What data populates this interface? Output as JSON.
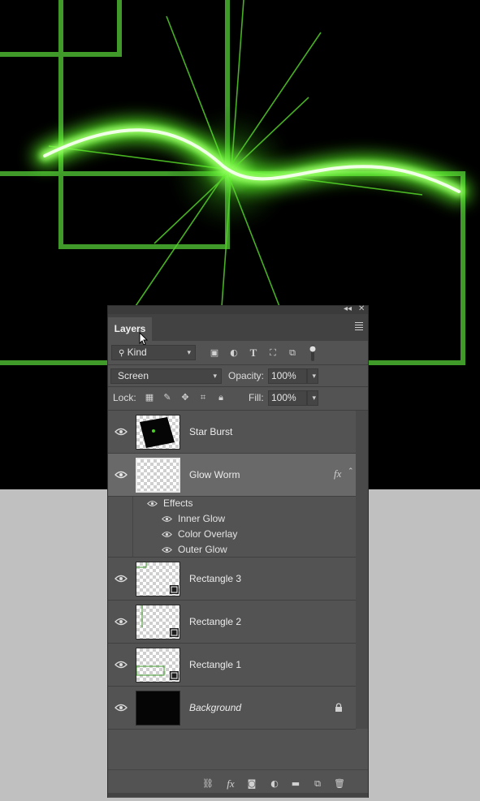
{
  "panel": {
    "collapse_label": "◂◂",
    "close_label": "✕",
    "tab_label": "Layers",
    "menu_icon": "panel-menu-icon"
  },
  "filter": {
    "kind_label": "Kind",
    "icons": [
      "pixel-filter-icon",
      "adjustment-filter-icon",
      "type-filter-icon",
      "shape-filter-icon",
      "smart-object-filter-icon",
      "filter-toggle-icon"
    ]
  },
  "blend": {
    "mode": "Screen",
    "opacity_label": "Opacity:",
    "opacity_value": "100%"
  },
  "lock": {
    "label": "Lock:",
    "fill_label": "Fill:",
    "fill_value": "100%"
  },
  "layers": [
    {
      "name": "Star Burst"
    },
    {
      "name": "Glow Worm",
      "fx": "fx",
      "selected": true
    },
    {
      "name": "Rectangle 3"
    },
    {
      "name": "Rectangle 2"
    },
    {
      "name": "Rectangle 1"
    },
    {
      "name": "Background",
      "locked": true
    }
  ],
  "effects": {
    "header": "Effects",
    "items": [
      "Inner Glow",
      "Color Overlay",
      "Outer Glow"
    ]
  },
  "bottom_icons": [
    "link-layers-icon",
    "fx-icon",
    "mask-icon",
    "adjustment-icon",
    "group-folder-icon",
    "new-layer-icon",
    "trash-icon"
  ],
  "fx_symbol": "fx",
  "colors": {
    "glow": "#7dff4a",
    "rect_stroke": "#3f9a2a",
    "panel_bg": "#535353",
    "selected_row": "#696969"
  }
}
